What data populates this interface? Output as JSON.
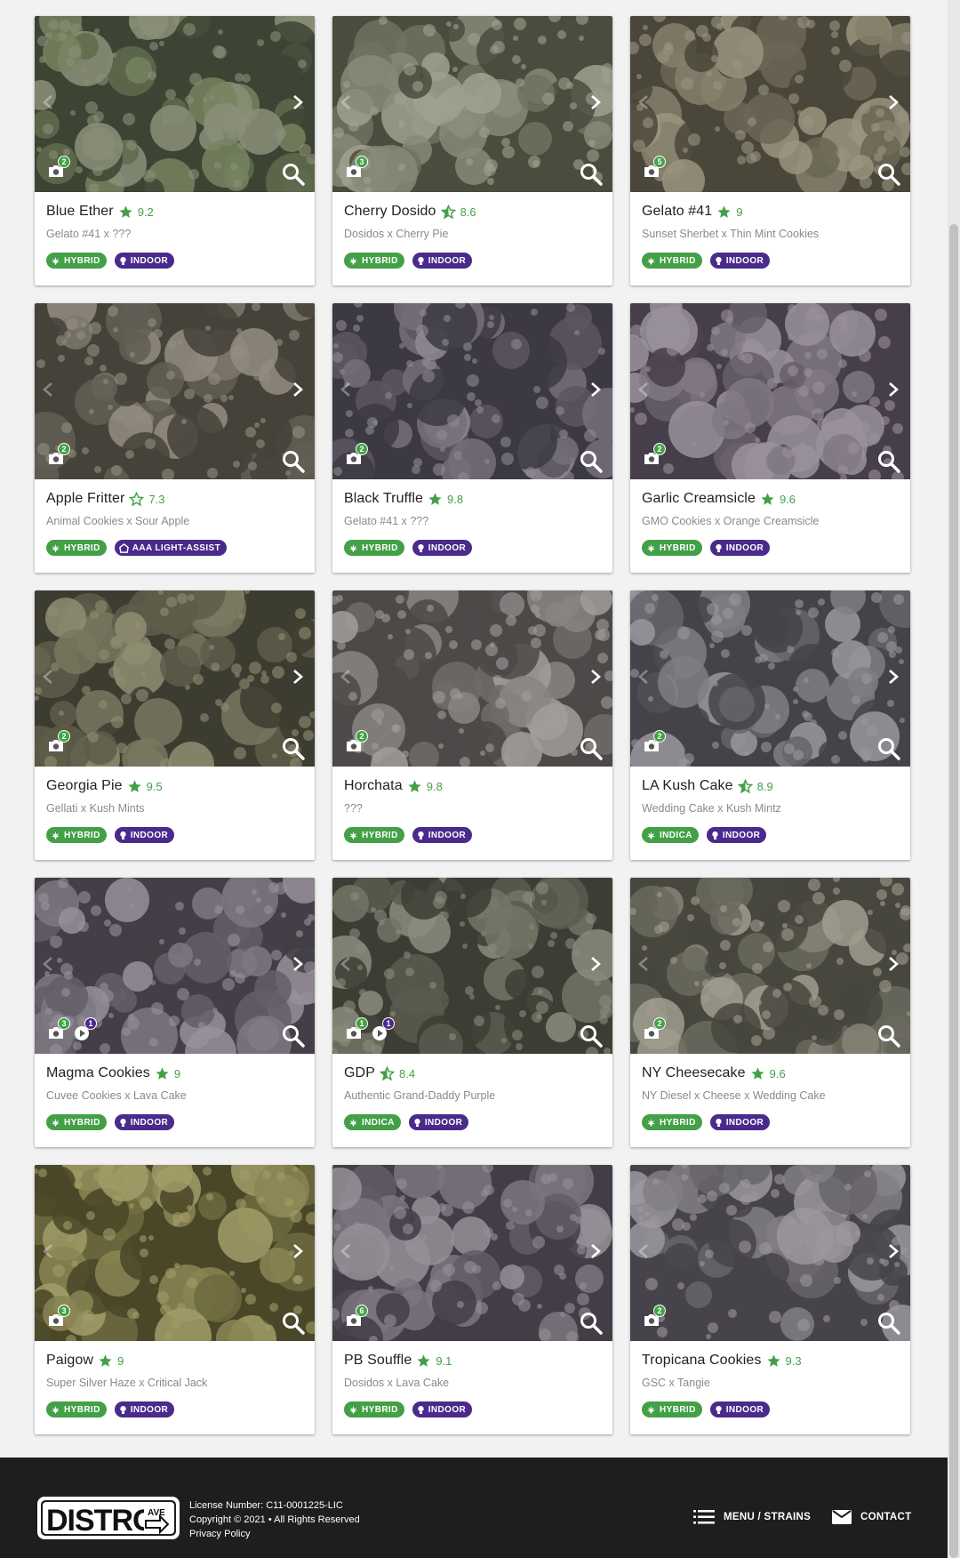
{
  "colors": {
    "accent_green": "#43a047",
    "accent_purple": "#4a2a8a",
    "footer_bg": "#1e1e1e"
  },
  "strains": [
    {
      "name": "Blue Ether",
      "rating": "9.2",
      "star": "full",
      "lineage": "Gelato #41 x ???",
      "photos": "2",
      "videos": null,
      "tags": [
        {
          "label": "HYBRID",
          "kind": "green",
          "icon": "leaf-icon"
        },
        {
          "label": "INDOOR",
          "kind": "purple",
          "icon": "bulb-icon"
        }
      ],
      "palette": [
        "#5f6b4e",
        "#76825f",
        "#3e4434",
        "#8a8f78"
      ]
    },
    {
      "name": "Cherry Dosido",
      "rating": "8.6",
      "star": "half",
      "lineage": "Dosidos x Cherry Pie",
      "photos": "3",
      "videos": null,
      "tags": [
        {
          "label": "HYBRID",
          "kind": "green",
          "icon": "leaf-icon"
        },
        {
          "label": "INDOOR",
          "kind": "purple",
          "icon": "bulb-icon"
        }
      ],
      "palette": [
        "#6e725e",
        "#878a77",
        "#4a4c3e",
        "#a0a08e"
      ]
    },
    {
      "name": "Gelato #41",
      "rating": "9",
      "star": "full",
      "lineage": "Sunset Sherbet x Thin Mint Cookies",
      "photos": "5",
      "videos": null,
      "tags": [
        {
          "label": "HYBRID",
          "kind": "green",
          "icon": "leaf-icon"
        },
        {
          "label": "INDOOR",
          "kind": "purple",
          "icon": "bulb-icon"
        }
      ],
      "palette": [
        "#6b6655",
        "#85806c",
        "#4a4639",
        "#9a9480"
      ]
    },
    {
      "name": "Apple Fritter",
      "rating": "7.3",
      "star": "outline",
      "lineage": "Animal Cookies x Sour Apple",
      "photos": "2",
      "videos": null,
      "tags": [
        {
          "label": "HYBRID",
          "kind": "green",
          "icon": "leaf-icon"
        },
        {
          "label": "AAA LIGHT-ASSIST",
          "kind": "purple",
          "icon": "house-icon"
        }
      ],
      "palette": [
        "#625e55",
        "#7c776c",
        "#45423a",
        "#938d80"
      ]
    },
    {
      "name": "Black Truffle",
      "rating": "9.8",
      "star": "full",
      "lineage": "Gelato #41 x ???",
      "photos": "2",
      "videos": null,
      "tags": [
        {
          "label": "HYBRID",
          "kind": "green",
          "icon": "leaf-icon"
        },
        {
          "label": "INDOOR",
          "kind": "purple",
          "icon": "bulb-icon"
        }
      ],
      "palette": [
        "#5a5660",
        "#74707a",
        "#3c3942",
        "#8e8a92"
      ]
    },
    {
      "name": "Garlic Creamsicle",
      "rating": "9.6",
      "star": "full",
      "lineage": "GMO Cookies x Orange Creamsicle",
      "photos": "2",
      "videos": null,
      "tags": [
        {
          "label": "HYBRID",
          "kind": "green",
          "icon": "leaf-icon"
        },
        {
          "label": "INDOOR",
          "kind": "purple",
          "icon": "bulb-icon"
        }
      ],
      "palette": [
        "#675e6b",
        "#807785",
        "#463e4a",
        "#9a909e"
      ]
    },
    {
      "name": "Georgia Pie",
      "rating": "9.5",
      "star": "full",
      "lineage": "Gellati x Kush Mints",
      "photos": "2",
      "videos": null,
      "tags": [
        {
          "label": "HYBRID",
          "kind": "green",
          "icon": "leaf-icon"
        },
        {
          "label": "INDOOR",
          "kind": "purple",
          "icon": "bulb-icon"
        }
      ],
      "palette": [
        "#5e5d4a",
        "#78775f",
        "#3d3c30",
        "#8f8d72"
      ]
    },
    {
      "name": "Horchata",
      "rating": "9.8",
      "star": "full",
      "lineage": "???",
      "photos": "2",
      "videos": null,
      "tags": [
        {
          "label": "HYBRID",
          "kind": "green",
          "icon": "leaf-icon"
        },
        {
          "label": "INDOOR",
          "kind": "purple",
          "icon": "bulb-icon"
        }
      ],
      "palette": [
        "#6f6b6a",
        "#8a8584",
        "#4c4948",
        "#a29d9b"
      ]
    },
    {
      "name": "LA Kush Cake",
      "rating": "8.9",
      "star": "half",
      "lineage": "Wedding Cake x Kush Mintz",
      "photos": "2",
      "videos": null,
      "tags": [
        {
          "label": "INDICA",
          "kind": "green",
          "icon": "leaf-icon"
        },
        {
          "label": "INDOOR",
          "kind": "purple",
          "icon": "bulb-icon"
        }
      ],
      "palette": [
        "#66646a",
        "#807d84",
        "#45434a",
        "#9a979d"
      ]
    },
    {
      "name": "Magma Cookies",
      "rating": "9",
      "star": "full",
      "lineage": "Cuvee Cookies x Lava Cake",
      "photos": "3",
      "videos": "1",
      "tags": [
        {
          "label": "HYBRID",
          "kind": "green",
          "icon": "leaf-icon"
        },
        {
          "label": "INDOOR",
          "kind": "purple",
          "icon": "bulb-icon"
        }
      ],
      "palette": [
        "#645e68",
        "#7e7882",
        "#433e47",
        "#98919b"
      ]
    },
    {
      "name": "GDP",
      "rating": "8.4",
      "star": "half",
      "lineage": "Authentic Grand-Daddy Purple",
      "photos": "1",
      "videos": "1",
      "tags": [
        {
          "label": "INDICA",
          "kind": "green",
          "icon": "leaf-icon"
        },
        {
          "label": "INDOOR",
          "kind": "purple",
          "icon": "bulb-icon"
        }
      ],
      "palette": [
        "#5a5b4f",
        "#737466",
        "#3c3d34",
        "#8b8c7d"
      ]
    },
    {
      "name": "NY Cheesecake",
      "rating": "9.6",
      "star": "full",
      "lineage": "NY Diesel x Cheese x Wedding Cake",
      "photos": "2",
      "videos": null,
      "tags": [
        {
          "label": "HYBRID",
          "kind": "green",
          "icon": "leaf-icon"
        },
        {
          "label": "INDOOR",
          "kind": "purple",
          "icon": "bulb-icon"
        }
      ],
      "palette": [
        "#6b6a5e",
        "#868477",
        "#48473e",
        "#a09d8f"
      ]
    },
    {
      "name": "Paigow",
      "rating": "9",
      "star": "full",
      "lineage": "Super Silver Haze x Critical Jack",
      "photos": "3",
      "videos": null,
      "tags": [
        {
          "label": "HYBRID",
          "kind": "green",
          "icon": "leaf-icon"
        },
        {
          "label": "INDOOR",
          "kind": "purple",
          "icon": "bulb-icon"
        }
      ],
      "palette": [
        "#6d6a3e",
        "#8a8653",
        "#4a4628",
        "#a29d68"
      ]
    },
    {
      "name": "PB Souffle",
      "rating": "9.1",
      "star": "full",
      "lineage": "Dosidos x Lava Cake",
      "photos": "6",
      "videos": null,
      "tags": [
        {
          "label": "HYBRID",
          "kind": "green",
          "icon": "leaf-icon"
        },
        {
          "label": "INDOOR",
          "kind": "purple",
          "icon": "bulb-icon"
        }
      ],
      "palette": [
        "#625c66",
        "#7c7680",
        "#423d46",
        "#958f98"
      ]
    },
    {
      "name": "Tropicana Cookies",
      "rating": "9.3",
      "star": "full",
      "lineage": "GSC x Tangie",
      "photos": "2",
      "videos": null,
      "tags": [
        {
          "label": "HYBRID",
          "kind": "green",
          "icon": "leaf-icon"
        },
        {
          "label": "INDOOR",
          "kind": "purple",
          "icon": "bulb-icon"
        }
      ],
      "palette": [
        "#67646a",
        "#817e84",
        "#46434a",
        "#9b979d"
      ]
    }
  ],
  "footer": {
    "logo_text": "DISTRO",
    "logo_sub": "AVE",
    "license": "License Number: C11-0001225-LIC",
    "copyright": "Copyright © 2021 • All Rights Reserved",
    "privacy": "Privacy Policy",
    "menu_label": "MENU / STRAINS",
    "contact_label": "CONTACT"
  }
}
